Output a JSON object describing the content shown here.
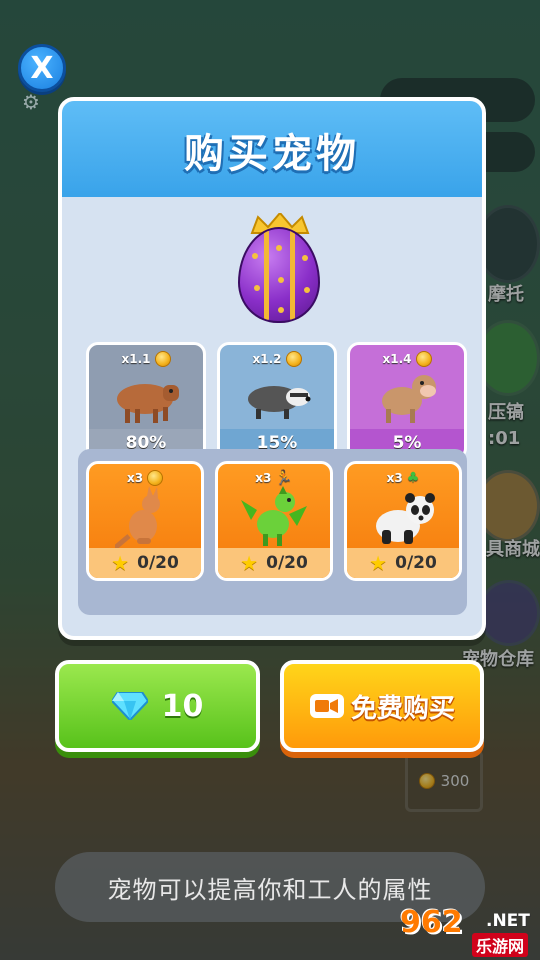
{
  "dialog": {
    "title": "购买宠物",
    "close_label": "X"
  },
  "rare_pets": [
    {
      "icon": "capybara-pet-icon",
      "multiplier": "x1.1",
      "bonus_icon": "coin-icon",
      "chance": "80%",
      "color": "#8f9db1"
    },
    {
      "icon": "badger-pet-icon",
      "multiplier": "x1.2",
      "bonus_icon": "coin-icon",
      "chance": "15%",
      "color": "#7cb6e0"
    },
    {
      "icon": "monkey-pet-icon",
      "multiplier": "x1.4",
      "bonus_icon": "coin-icon",
      "chance": "5%",
      "color": "#c56fd8"
    }
  ],
  "collect_pets": [
    {
      "icon": "kangaroo-pet-icon",
      "multiplier": "x3",
      "bonus_icon": "coin-icon",
      "progress": "0/20"
    },
    {
      "icon": "dragon-pet-icon",
      "multiplier": "x3",
      "bonus_icon": "runner-speed-icon",
      "progress": "0/20"
    },
    {
      "icon": "panda-pet-icon",
      "multiplier": "x3",
      "bonus_icon": "clover-luck-icon",
      "progress": "0/20"
    }
  ],
  "buttons": {
    "gem_cost": "10",
    "free_buy_label": "免费购买"
  },
  "hint": "宠物可以提高你和工人的属性",
  "background": {
    "labels": [
      "摩托",
      "压镐",
      ":01",
      "具商城",
      "宠物仓库"
    ],
    "price": "300"
  },
  "watermark": {
    "number": "962",
    "suffix": ".NET",
    "site": "乐游网"
  }
}
